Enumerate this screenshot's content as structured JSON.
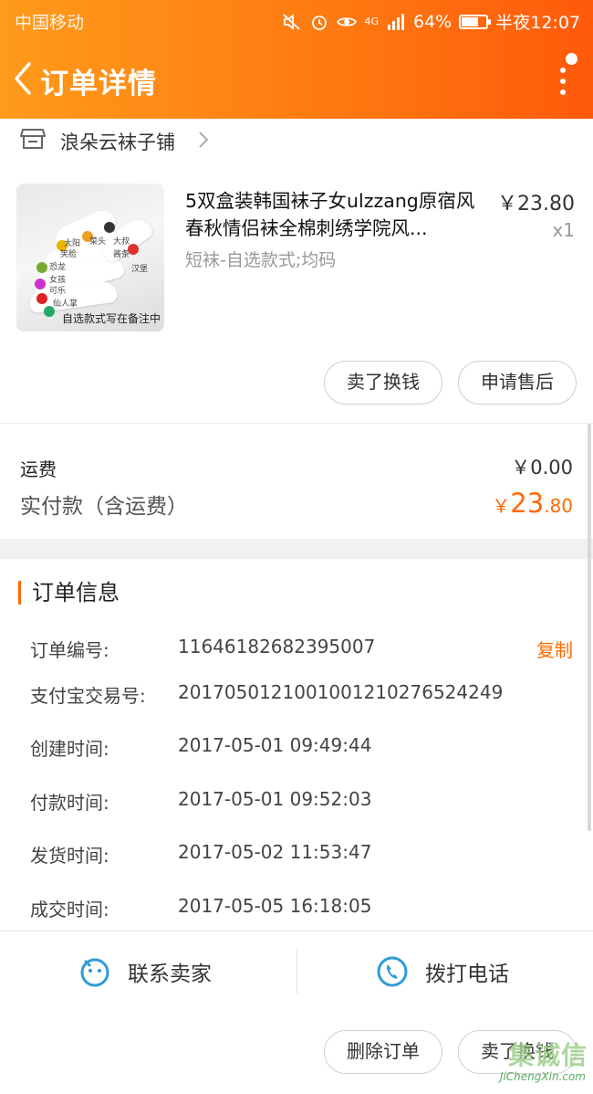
{
  "statusbar": {
    "carrier": "中国移动",
    "battery_pct": "64%",
    "time": "半夜12:07",
    "network": "4G",
    "battery_level": 0.64
  },
  "nav": {
    "title": "订单详情"
  },
  "shop": {
    "name": "浪朵云袜子铺"
  },
  "product": {
    "title": "5双盒装韩国袜子女ulzzang原宿风春秋情侣袜全棉刺绣学院风...",
    "price": "￥23.80",
    "qty": "x1",
    "spec": "短袜-自选款式;均码",
    "thumb_caption": "自选款式写在备注中",
    "thumb_labels": [
      "太阳",
      "笑脸",
      "菜头",
      "大叔",
      "酱条",
      "汉堡",
      "恐龙",
      "女孩",
      "可乐",
      "仙人掌"
    ]
  },
  "item_actions": {
    "sell": "卖了换钱",
    "after_sale": "申请售后"
  },
  "fees": {
    "shipping_label": "运费",
    "shipping_value": "￥0.00",
    "paid_label": "实付款（含运费）",
    "paid_currency": "￥",
    "paid_int": "23",
    "paid_dec": ".80"
  },
  "order_info": {
    "title": "订单信息",
    "copy": "复制",
    "rows": [
      {
        "label": "订单编号:",
        "value": "11646182682395007"
      },
      {
        "label": "支付宝交易号:",
        "value": "2017050121001001210276524249"
      },
      {
        "label": "创建时间:",
        "value": "2017-05-01 09:49:44"
      },
      {
        "label": "付款时间:",
        "value": "2017-05-01 09:52:03"
      },
      {
        "label": "发货时间:",
        "value": "2017-05-02 11:53:47"
      },
      {
        "label": "成交时间:",
        "value": "2017-05-05 16:18:05"
      }
    ]
  },
  "bottom_bar": {
    "contact_seller": "联系卖家",
    "call": "拨打电话"
  },
  "bottom_actions": {
    "delete_order": "删除订单",
    "sell": "卖了换钱"
  },
  "watermark": {
    "main": "集诚信",
    "sub": "JiChengXin.com"
  },
  "colors": {
    "accent": "#ff6a00",
    "header_start": "#ff9a1a",
    "header_end": "#ff5a0a",
    "icon_blue": "#2f9bd8"
  }
}
